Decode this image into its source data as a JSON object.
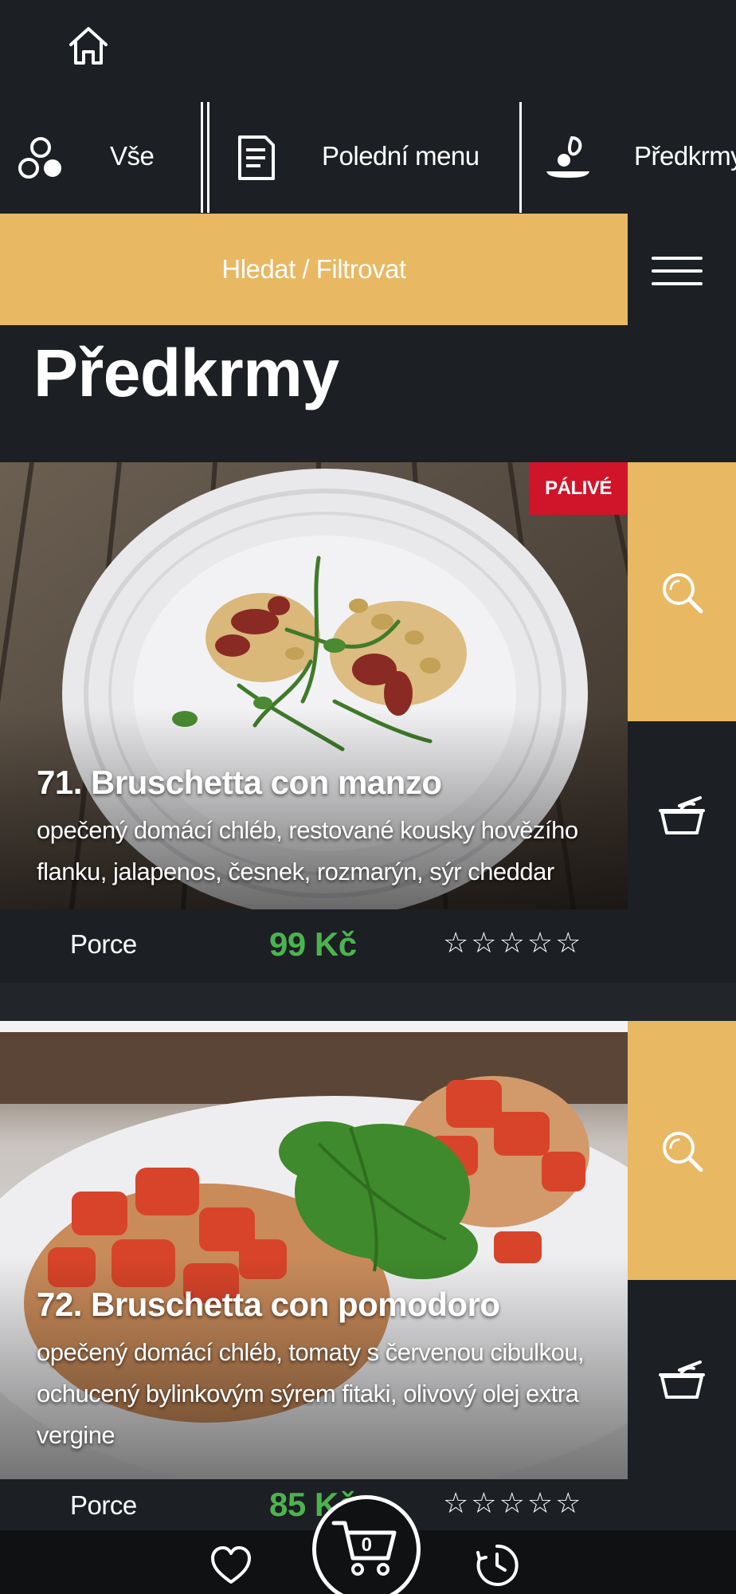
{
  "nav": {
    "home_icon": "home-icon"
  },
  "tabs": [
    {
      "label": "Vše",
      "icon": "circles-icon"
    },
    {
      "label": "Polední menu",
      "icon": "document-icon"
    },
    {
      "label": "Předkrmy",
      "icon": "plate-leaf-icon"
    }
  ],
  "filter": {
    "label": "Hledat / Filtrovat"
  },
  "section": {
    "title": "Předkrmy"
  },
  "items": [
    {
      "badge": "PÁLIVÉ",
      "title": "71. Bruschetta con manzo",
      "description": "opečený domácí chléb, restované kousky hovězího flanku, jalapenos, česnek, rozmarýn, sýr cheddar",
      "portion_label": "Porce",
      "price": "99 Kč",
      "rating": 0
    },
    {
      "title": "72. Bruschetta con pomodoro",
      "description": "opečený domácí chléb, tomaty s červenou cibulkou, ochucený bylinkovým sýrem fitaki, olivový olej extra vergine",
      "portion_label": "Porce",
      "price": "85 Kč",
      "rating": 0
    }
  ],
  "bottom_nav": {
    "cart_count": "0"
  },
  "colors": {
    "background": "#1c1f23",
    "accent": "#e8b862",
    "price": "#4cb34f",
    "badge": "#d0142a"
  }
}
